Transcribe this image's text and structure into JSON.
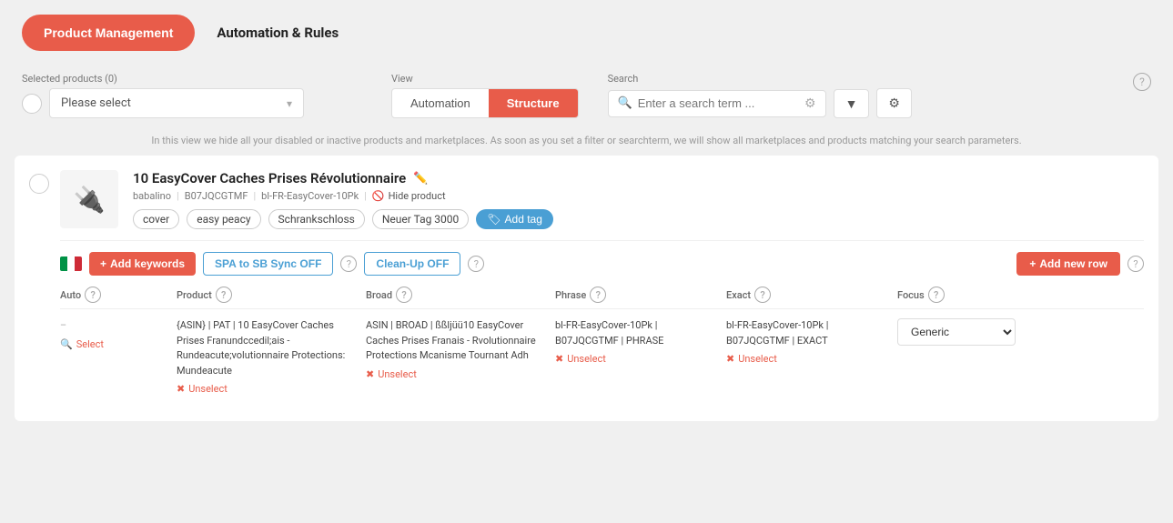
{
  "header": {
    "product_mgmt_label": "Product Management",
    "automation_rules_label": "Automation & Rules"
  },
  "toolbar": {
    "selected_products_label": "Selected products (0)",
    "please_select_placeholder": "Please select",
    "view_label": "View",
    "view_automation": "Automation",
    "view_structure": "Structure",
    "search_label": "Search",
    "search_placeholder": "Enter a search term ...",
    "filter_icon": "▼",
    "settings_icon": "⚙"
  },
  "info_bar": {
    "text": "In this view we hide all your disabled or inactive products and marketplaces. As soon as you set a filter or searchterm, we will show all marketplaces and products matching your search parameters."
  },
  "product": {
    "title": "10 EasyCover Caches Prises Révolutionnaire",
    "seller": "babalino",
    "asin": "B07JQCGTMF",
    "sku": "bl-FR-EasyCover-10Pk",
    "hide_label": "Hide product",
    "tags": [
      "cover",
      "easy peacy",
      "Schrankschloss",
      "Neuer Tag 3000"
    ],
    "add_tag_label": "Add tag",
    "add_keywords_label": "+ Add keywords",
    "sync_label": "SPA to SB Sync OFF",
    "cleanup_label": "Clean-Up OFF",
    "add_new_row_label": "+ Add new row"
  },
  "table": {
    "headers": [
      "Auto",
      "Product",
      "Broad",
      "Phrase",
      "Exact",
      "Focus"
    ],
    "row": {
      "auto_dash": "–",
      "auto_select": "Select",
      "product_text": "{ASIN} | PAT | 10 EasyCover Caches Prises Franundccedil;ais - Rundeacute;volutionnaire Protections: Mundeacute",
      "product_unselect": "Unselect",
      "broad_text": "ASIN | BROAD | ßßljüü10 EasyCover Caches Prises Franais - Rvolutionnaire Protections Mcanisme Tournant Adh",
      "broad_unselect": "Unselect",
      "phrase_text": "bl-FR-EasyCover-10Pk | B07JQCGTMF | PHRASE",
      "phrase_unselect": "Unselect",
      "exact_text": "bl-FR-EasyCover-10Pk | B07JQCGTMF | EXACT",
      "exact_unselect": "Unselect",
      "focus_value": "Generic"
    }
  }
}
